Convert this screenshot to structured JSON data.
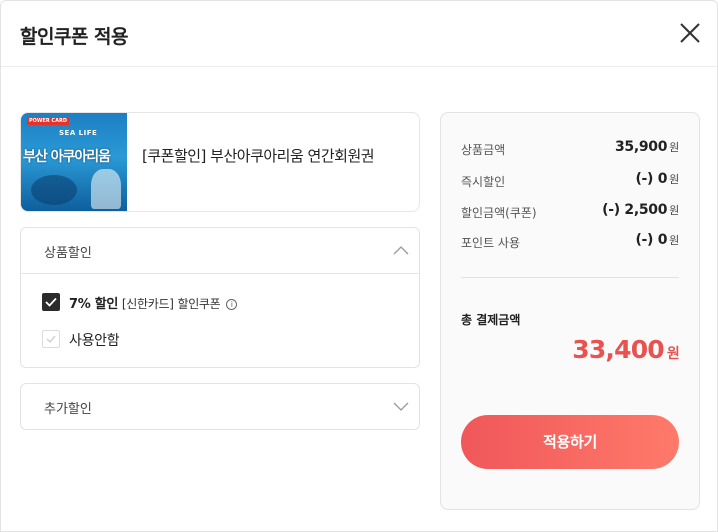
{
  "header": {
    "title": "할인쿠폰 적용"
  },
  "product": {
    "thumbnail": {
      "badge": "POWER CARD",
      "logo": "SEA LIFE",
      "text": "부산 아쿠아리움"
    },
    "name": "[쿠폰할인] 부산아쿠아리움 연간회원권"
  },
  "product_discount": {
    "title": "상품할인",
    "expanded": true,
    "options": [
      {
        "percent": "7% 할인",
        "card": "[신한카드]",
        "suffix": "할인쿠폰",
        "checked": true
      },
      {
        "label": "사용안함",
        "checked": false
      }
    ]
  },
  "extra_discount": {
    "title": "추가할인",
    "expanded": false
  },
  "summary": {
    "rows": [
      {
        "label": "상품금액",
        "value": "35,900"
      },
      {
        "label": "즉시할인",
        "value": "(-) 0"
      },
      {
        "label": "할인금액(쿠폰)",
        "value": "(-) 2,500"
      },
      {
        "label": "포인트 사용",
        "value": "(-) 0"
      }
    ],
    "unit": "원",
    "total_label": "총 결제금액",
    "total_value": "33,400",
    "apply_label": "적용하기"
  },
  "colors": {
    "accent": "#e8534f",
    "button_start": "#f0575a",
    "button_end": "#ff7a6a"
  }
}
